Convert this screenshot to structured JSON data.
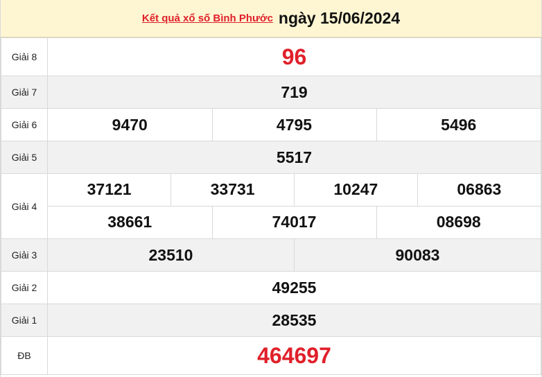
{
  "header": {
    "title_link": "Kết quả xổ số Bình Phước",
    "date_text": "ngày 15/06/2024"
  },
  "prizes": {
    "g8": {
      "label": "Giải 8",
      "values": [
        "96"
      ]
    },
    "g7": {
      "label": "Giải 7",
      "values": [
        "719"
      ]
    },
    "g6": {
      "label": "Giải 6",
      "values": [
        "9470",
        "4795",
        "5496"
      ]
    },
    "g5": {
      "label": "Giải 5",
      "values": [
        "5517"
      ]
    },
    "g4": {
      "label": "Giải 4",
      "values": [
        "37121",
        "33731",
        "10247",
        "06863",
        "38661",
        "74017",
        "08698"
      ]
    },
    "g3": {
      "label": "Giải 3",
      "values": [
        "23510",
        "90083"
      ]
    },
    "g2": {
      "label": "Giải 2",
      "values": [
        "49255"
      ]
    },
    "g1": {
      "label": "Giải 1",
      "values": [
        "28535"
      ]
    },
    "db": {
      "label": "ĐB",
      "values": [
        "464697"
      ]
    }
  },
  "colors": {
    "highlight": "#e0202a",
    "header_bg": "#fef6d3",
    "alt_row_bg": "#f1f1f1"
  }
}
